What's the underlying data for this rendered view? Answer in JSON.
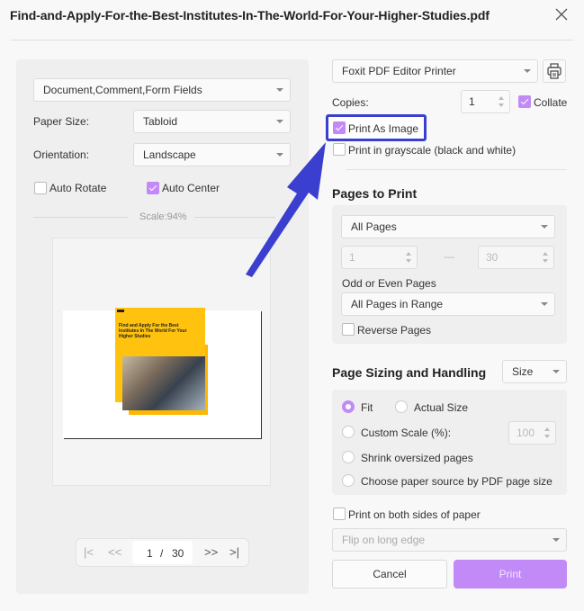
{
  "window": {
    "title": "Find-and-Apply-For-the-Best-Institutes-In-The-World-For-Your-Higher-Studies.pdf",
    "close_icon": "close-icon"
  },
  "left": {
    "content_select": "Document,Comment,Form Fields",
    "paper_size_label": "Paper Size:",
    "paper_size_value": "Tabloid",
    "orientation_label": "Orientation:",
    "orientation_value": "Landscape",
    "auto_rotate": {
      "label": "Auto Rotate",
      "checked": false
    },
    "auto_center": {
      "label": "Auto Center",
      "checked": true
    },
    "scale_text": "Scale:94%",
    "preview": {
      "cover_title": "Find and Apply For the Best Institutes In The World For Your Higher Studies"
    },
    "pager": {
      "first": "|<",
      "prev": "<<",
      "current": "1",
      "separator": "/",
      "total": "30",
      "next": ">>",
      "last": ">|"
    }
  },
  "right": {
    "printer": "Foxit PDF Editor Printer",
    "printer_properties_icon": "printer-icon",
    "copies_label": "Copies:",
    "copies_value": "1",
    "collate": {
      "label": "Collate",
      "checked": true
    },
    "print_as_image": {
      "label": "Print As Image",
      "checked": true
    },
    "grayscale": {
      "label": "Print in grayscale (black and white)",
      "checked": false
    },
    "pages_to_print": {
      "title": "Pages to Print",
      "range_select": "All Pages",
      "from": "1",
      "dash": "—",
      "to": "30",
      "odd_even_label": "Odd or Even Pages",
      "odd_even_value": "All Pages in Range",
      "reverse": {
        "label": "Reverse Pages",
        "checked": false
      }
    },
    "sizing": {
      "title": "Page Sizing and Handling",
      "mode_select": "Size",
      "fit": {
        "label": "Fit",
        "checked": true
      },
      "actual": {
        "label": "Actual Size",
        "checked": false
      },
      "custom": {
        "label": "Custom Scale (%):",
        "checked": false,
        "value": "100"
      },
      "shrink": {
        "label": "Shrink oversized pages",
        "checked": false
      },
      "paper_source": {
        "label": "Choose paper source by PDF page size",
        "checked": false
      }
    },
    "duplex": {
      "label": "Print on both sides of paper",
      "checked": false,
      "flip_select": "Flip on long edge"
    },
    "cancel_label": "Cancel",
    "print_label": "Print"
  },
  "colors": {
    "accent": "#c28af7",
    "highlight": "#3a3fcf",
    "arrow": "#3a3fcf"
  }
}
